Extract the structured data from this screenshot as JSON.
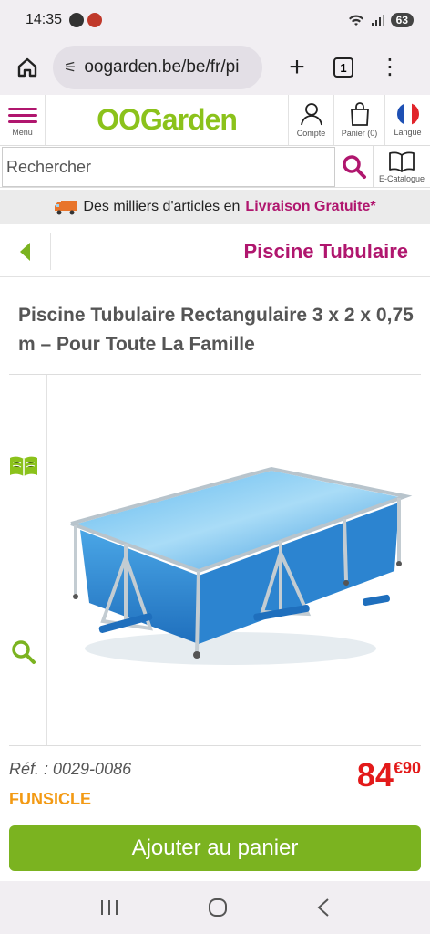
{
  "status": {
    "time": "14:35",
    "battery": "63"
  },
  "browser": {
    "url": "oogarden.be/be/fr/pi",
    "tab_count": "1"
  },
  "header": {
    "menu_label": "Menu",
    "logo": "OOGarden",
    "account_label": "Compte",
    "cart_label": "Panier (0)",
    "language_label": "Langue"
  },
  "search": {
    "placeholder": "Rechercher",
    "catalog_label": "E-Catalogue"
  },
  "promo": {
    "text": "Des milliers d'articles en",
    "highlight": "Livraison Gratuite*"
  },
  "category": {
    "title": "Piscine Tubulaire"
  },
  "product": {
    "title": "Piscine Tubulaire Rectangulaire 3 x 2 x 0,75 m – Pour Toute La Famille",
    "ref": "Réf. : 0029-0086",
    "brand": "FUNSICLE",
    "price_int": "84",
    "price_dec": "€90",
    "add_to_cart": "Ajouter au panier"
  },
  "colors": {
    "brand_green": "#8bc21b",
    "accent_magenta": "#b0166e",
    "price_red": "#e31a1a",
    "brand_orange": "#f39a14",
    "button_green": "#7bb320"
  },
  "icons": [
    "home-icon",
    "tune-icon",
    "plus-icon",
    "tabs-icon",
    "more-icon",
    "menu-icon",
    "user-icon",
    "bag-icon",
    "flag-fr-icon",
    "search-icon",
    "catalog-book-icon",
    "truck-icon",
    "chevron-left-icon",
    "open-book-icon",
    "zoom-icon",
    "recents-icon",
    "home-circle-icon",
    "back-icon"
  ]
}
